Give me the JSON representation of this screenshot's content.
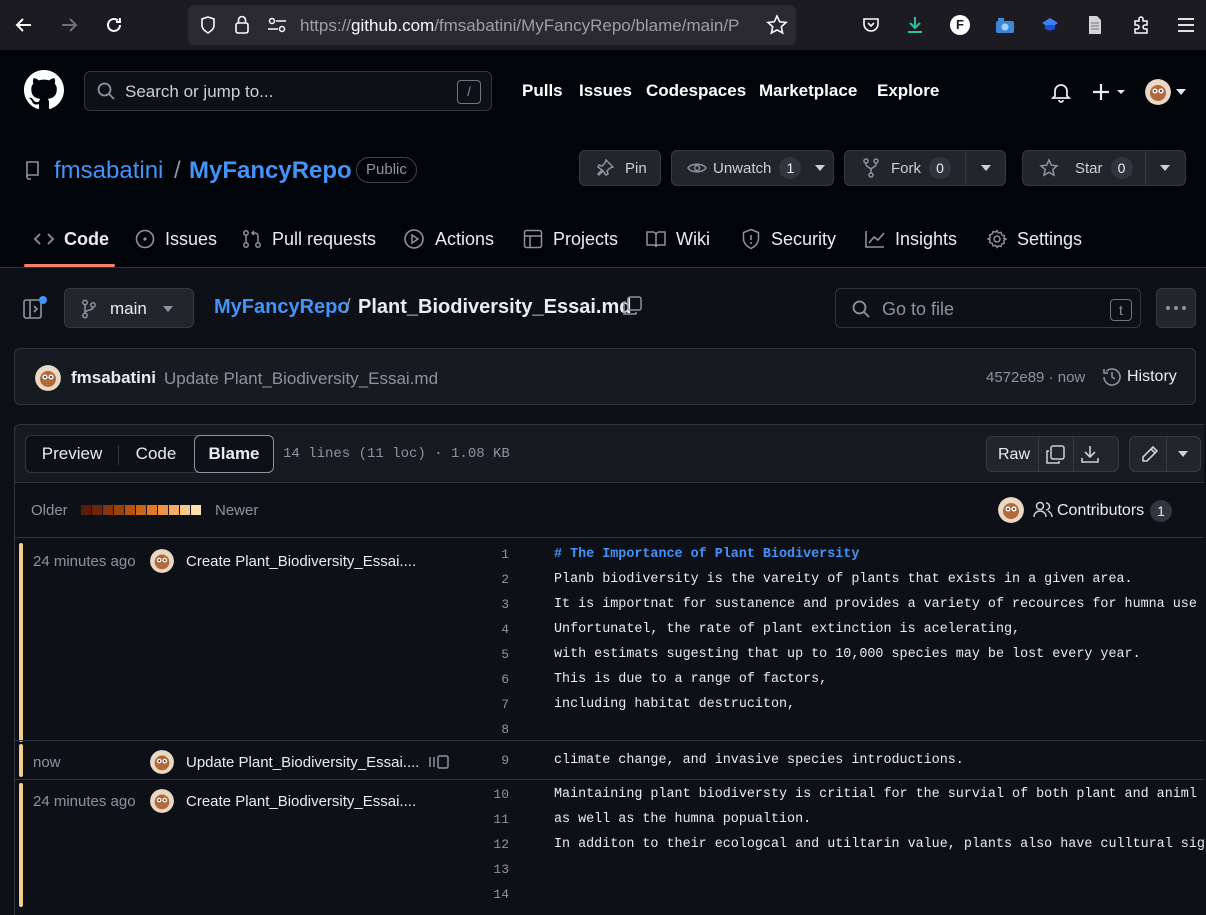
{
  "browser": {
    "url_prefix": "https://",
    "url_host": "github.com",
    "url_path": "/fmsabatini/MyFancyRepo/blame/main/P",
    "profile_letter": "F"
  },
  "header": {
    "search_placeholder": "Search or jump to...",
    "search_key": "/",
    "nav": [
      "Pulls",
      "Issues",
      "Codespaces",
      "Marketplace",
      "Explore"
    ]
  },
  "repo": {
    "owner": "fmsabatini",
    "separator": "/",
    "name": "MyFancyRepo",
    "visibility": "Public",
    "pin_label": "Pin",
    "watch_label": "Unwatch",
    "watch_count": "1",
    "fork_label": "Fork",
    "fork_count": "0",
    "star_label": "Star",
    "star_count": "0"
  },
  "tabs": [
    {
      "label": "Code",
      "icon": "code-icon",
      "active": true
    },
    {
      "label": "Issues",
      "icon": "issue-icon"
    },
    {
      "label": "Pull requests",
      "icon": "pull-request-icon"
    },
    {
      "label": "Actions",
      "icon": "play-icon"
    },
    {
      "label": "Projects",
      "icon": "table-icon"
    },
    {
      "label": "Wiki",
      "icon": "book-icon"
    },
    {
      "label": "Security",
      "icon": "shield-icon"
    },
    {
      "label": "Insights",
      "icon": "graph-icon"
    },
    {
      "label": "Settings",
      "icon": "gear-icon"
    }
  ],
  "file_nav": {
    "branch": "main",
    "crumb_repo": "MyFancyRepo",
    "crumb_sep": "/",
    "crumb_file": "Plant_Biodiversity_Essai.md",
    "goto_placeholder": "Go to file",
    "goto_key": "t"
  },
  "commit": {
    "author": "fmsabatini",
    "message": "Update Plant_Biodiversity_Essai.md",
    "sha_time": "4572e89 · now",
    "history_label": "History"
  },
  "file_toolbar": {
    "modes": [
      "Preview",
      "Code",
      "Blame"
    ],
    "active_mode": "Blame",
    "file_info": "14 lines (11 loc) · 1.08 KB",
    "raw_label": "Raw"
  },
  "legend": {
    "older": "Older",
    "newer": "Newer",
    "colors": [
      "#5c1d06",
      "#6f2608",
      "#863409",
      "#9c430c",
      "#b5530f",
      "#cd6415",
      "#e0792a",
      "#ed9246",
      "#f5ac67",
      "#f9c88d",
      "#fde1b0"
    ],
    "contributors_label": "Contributors",
    "contributors_count": "1"
  },
  "blame": [
    {
      "time": "24 minutes ago",
      "message": "Create Plant_Biodiversity_Essai....",
      "lines": [
        1,
        2,
        3,
        4,
        5,
        6,
        7,
        8
      ],
      "color": "#f2cc8f"
    },
    {
      "time": "now",
      "message": "Update Plant_Biodiversity_Essai....",
      "lines": [
        9
      ],
      "color": "#f2cc8f"
    },
    {
      "time": "24 minutes ago",
      "message": "Create Plant_Biodiversity_Essai....",
      "lines": [
        10,
        11,
        12,
        13,
        14
      ],
      "color": "#f2cc8f"
    }
  ],
  "code": [
    "# The Importance of Plant Biodiversity",
    "Planb biodiversity is the vareity of plants that exists in a given area.",
    "It is importnat for sustanence and provides a variety of recources for humna use",
    "Unfortunatel, the rate of plant extinction is acelerating,",
    "with estimats sugesting that up to 10,000 species may be lost every year.",
    "This is due to a range of factors,",
    "including habitat destruciton,",
    "",
    "climate change, and invasive species introductions.",
    "Maintaining plant biodiversty is critial for the survial of both plant and animl",
    "as well as the humna popualtion.",
    "In additon to their ecologcal and utiltarin value, plants also have culltural sig",
    "",
    ""
  ]
}
